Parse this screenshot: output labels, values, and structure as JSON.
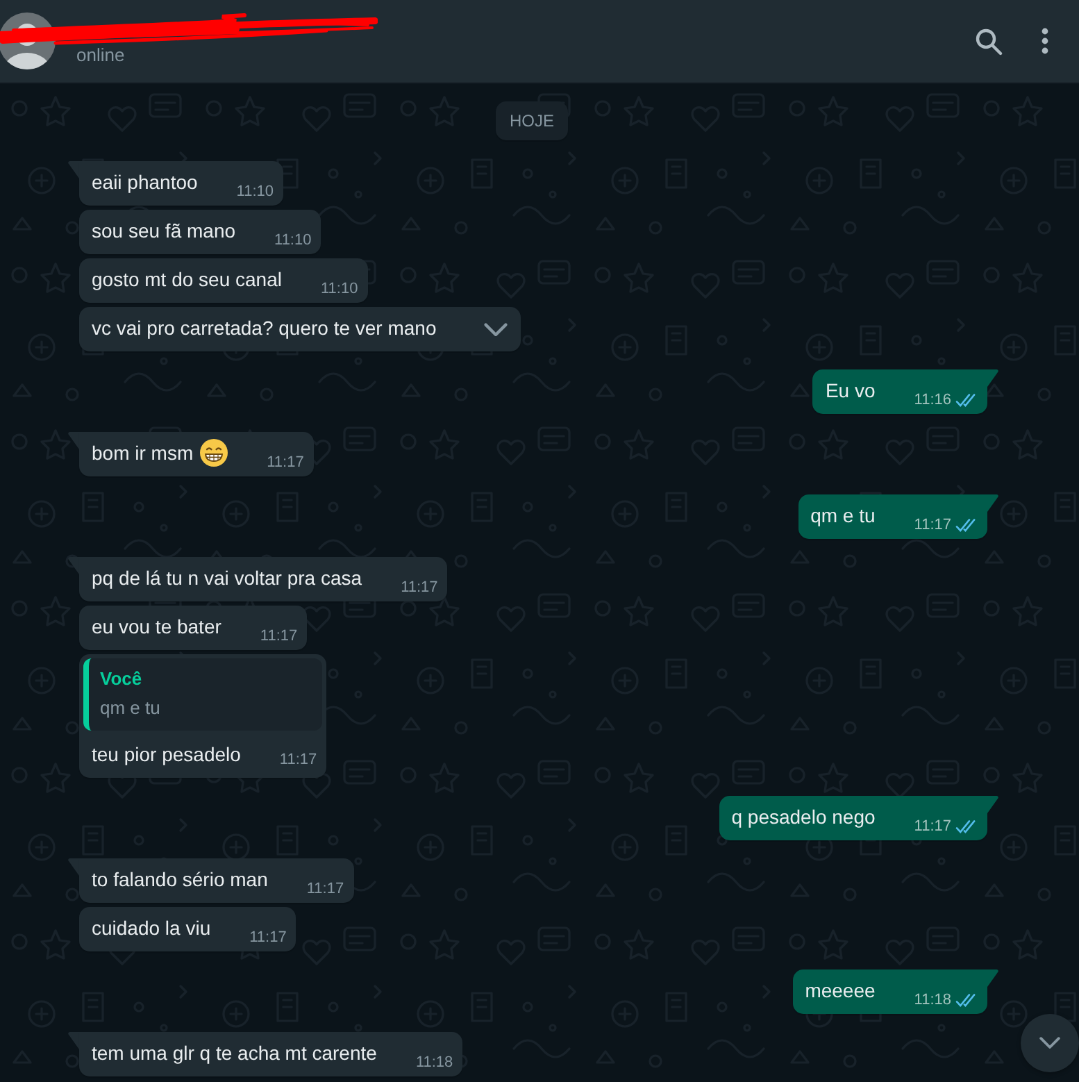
{
  "header": {
    "status": "online"
  },
  "date_divider": "HOJE",
  "messages": [
    {
      "kind": "incoming",
      "text": "eaii phantoo",
      "time": "11:10",
      "emoji": false,
      "hovered": false
    },
    {
      "kind": "incoming",
      "text": "sou seu fã mano",
      "time": "11:10",
      "emoji": false,
      "hovered": false
    },
    {
      "kind": "incoming",
      "text": "gosto mt do seu canal",
      "time": "11:10",
      "emoji": false,
      "hovered": false
    },
    {
      "kind": "incoming",
      "text": "vc vai pro carretada? quero te ver mano",
      "emoji": false,
      "hovered": true
    },
    {
      "kind": "outgoing",
      "text": "Eu vo",
      "time": "11:16",
      "read": true,
      "emoji": false,
      "hovered": false
    },
    {
      "kind": "incoming",
      "text": "bom ir msm",
      "time": "11:17",
      "emoji": true,
      "hovered": false
    },
    {
      "kind": "outgoing",
      "text": "qm e tu",
      "time": "11:17",
      "read": true,
      "emoji": false,
      "hovered": false
    },
    {
      "kind": "incoming",
      "text": "pq de lá tu n vai voltar pra casa",
      "time": "11:17",
      "emoji": false,
      "hovered": false
    },
    {
      "kind": "incoming",
      "text": "eu vou te bater",
      "time": "11:17",
      "emoji": false,
      "hovered": false
    },
    {
      "kind": "incoming",
      "quote": {
        "author": "Você",
        "text": "qm e tu"
      },
      "text": "teu pior pesadelo",
      "time": "11:17",
      "emoji": false,
      "hovered": false
    },
    {
      "kind": "outgoing",
      "text": "q pesadelo nego",
      "time": "11:17",
      "read": true,
      "emoji": false,
      "hovered": false
    },
    {
      "kind": "incoming",
      "text": "to falando sério man",
      "time": "11:17",
      "emoji": false,
      "hovered": false
    },
    {
      "kind": "incoming",
      "text": "cuidado la viu",
      "time": "11:17",
      "emoji": false,
      "hovered": false
    },
    {
      "kind": "outgoing",
      "text": "meeeee",
      "time": "11:18",
      "read": true,
      "emoji": false,
      "hovered": false
    },
    {
      "kind": "incoming",
      "text": "tem uma glr q te acha mt carente",
      "time": "11:18",
      "emoji": false,
      "hovered": false
    }
  ]
}
